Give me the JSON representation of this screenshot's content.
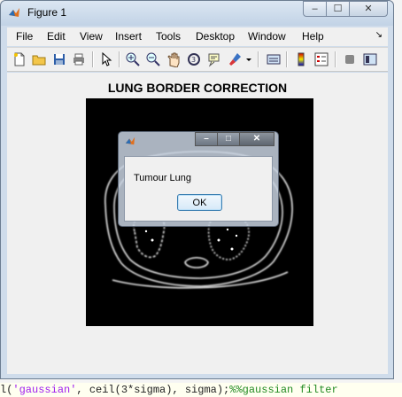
{
  "window": {
    "title": "Figure 1"
  },
  "menubar": {
    "items": [
      "File",
      "Edit",
      "View",
      "Insert",
      "Tools",
      "Desktop",
      "Window",
      "Help"
    ],
    "overflow_arrow": "↘"
  },
  "toolbar": {
    "icons": [
      "new-figure-icon",
      "open-file-icon",
      "save-icon",
      "print-icon",
      "edit-plot-pointer-icon",
      "zoom-in-icon",
      "zoom-out-icon",
      "pan-hand-icon",
      "rotate-3d-icon",
      "data-cursor-icon",
      "brush-icon",
      "brush-dropdown-icon",
      "link-plot-icon",
      "colorbar-icon",
      "legend-icon",
      "hide-plot-tools-icon",
      "show-plot-tools-icon"
    ]
  },
  "figure": {
    "plot_title": "LUNG BORDER CORRECTION"
  },
  "dialog": {
    "message": "Tumour Lung",
    "ok_label": "OK"
  },
  "background_code": {
    "prefix": "l(",
    "str": "'gaussian'",
    "mid": ", ceil(3*sigma), sigma);",
    "comment": "%%gaussian filter"
  },
  "colors": {
    "axes_bg": "#000000",
    "edge": "#ffffff",
    "ok_border": "#3c7fb1"
  }
}
